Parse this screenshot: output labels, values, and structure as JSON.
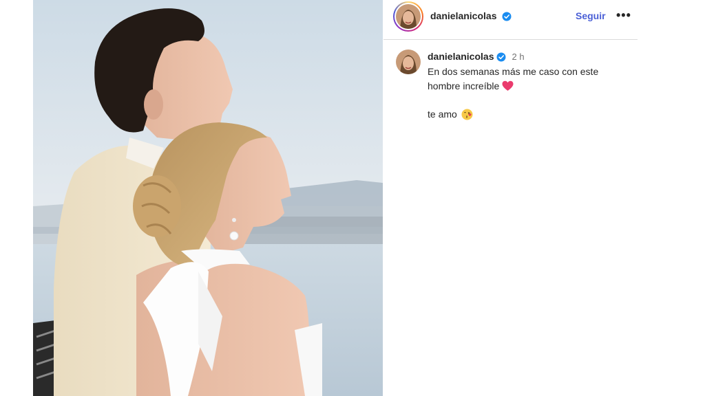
{
  "post": {
    "image_icon": "photo-couple",
    "author": {
      "username": "danielanicolas",
      "verified": true,
      "avatar_icon": "profile-avatar-icon"
    },
    "follow_label": "Seguir",
    "more_icon": "more-options-icon",
    "more_label": "•••"
  },
  "comment": {
    "username": "danielanicolas",
    "time": "2 h",
    "line1": "En dos semanas más me caso con este",
    "line2": "hombre increíble",
    "line2_emoji": "heart-icon",
    "line3": "te amo",
    "line3_emoji": "kiss-face-icon"
  },
  "colors": {
    "follow": "#4a5fd6",
    "verified": "#1a8cf0",
    "divider": "#dbdbdb",
    "heart": "#ea3b6d"
  }
}
